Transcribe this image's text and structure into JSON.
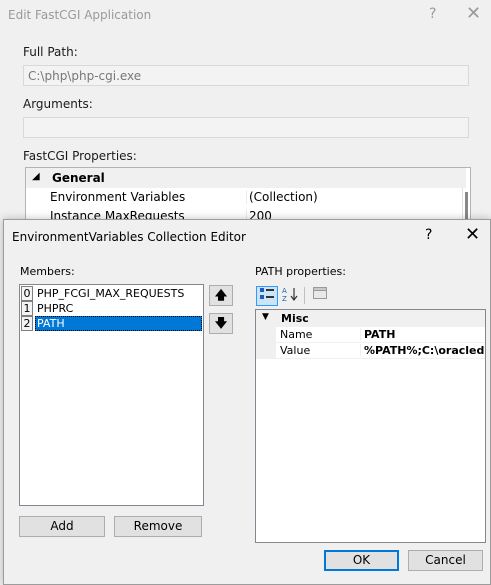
{
  "background_dialog": {
    "title": "Edit FastCGI Application",
    "help_glyph": "?",
    "close_glyph": "✕",
    "full_path_label": "Full Path:",
    "full_path_value": "C:\\php\\php-cgi.exe",
    "arguments_label": "Arguments:",
    "arguments_value": "",
    "properties_label": "FastCGI Properties:",
    "grid": {
      "category": "General",
      "rows": [
        {
          "name": "Environment Variables",
          "value": "(Collection)"
        },
        {
          "name": "Instance MaxRequests",
          "value": "200"
        }
      ]
    }
  },
  "editor": {
    "title": "EnvironmentVariables Collection Editor",
    "help_glyph": "?",
    "close_glyph": "✕",
    "members_label": "Members:",
    "members": [
      {
        "index": "0",
        "name": "PHP_FCGI_MAX_REQUESTS"
      },
      {
        "index": "1",
        "name": "PHPRC"
      },
      {
        "index": "2",
        "name": "PATH"
      }
    ],
    "selected_member_index": 2,
    "move_up_glyph": "🡅",
    "move_down_glyph": "🡇",
    "add_label": "Add",
    "remove_label": "Remove",
    "properties_label": "PATH properties:",
    "toolbar": {
      "categorized_icon": "categorized-icon",
      "alphabetical_icon": "alphabetical-icon",
      "property_pages_icon": "property-pages-icon"
    },
    "property_grid": {
      "category": "Misc",
      "rows": [
        {
          "name": "Name",
          "value": "PATH"
        },
        {
          "name": "Value",
          "value": "%PATH%;C:\\oracledr"
        }
      ]
    },
    "ok_label": "OK",
    "cancel_label": "Cancel"
  },
  "colors": {
    "selection": "#0078d7",
    "dialog_bg": "#f0f0f0"
  }
}
